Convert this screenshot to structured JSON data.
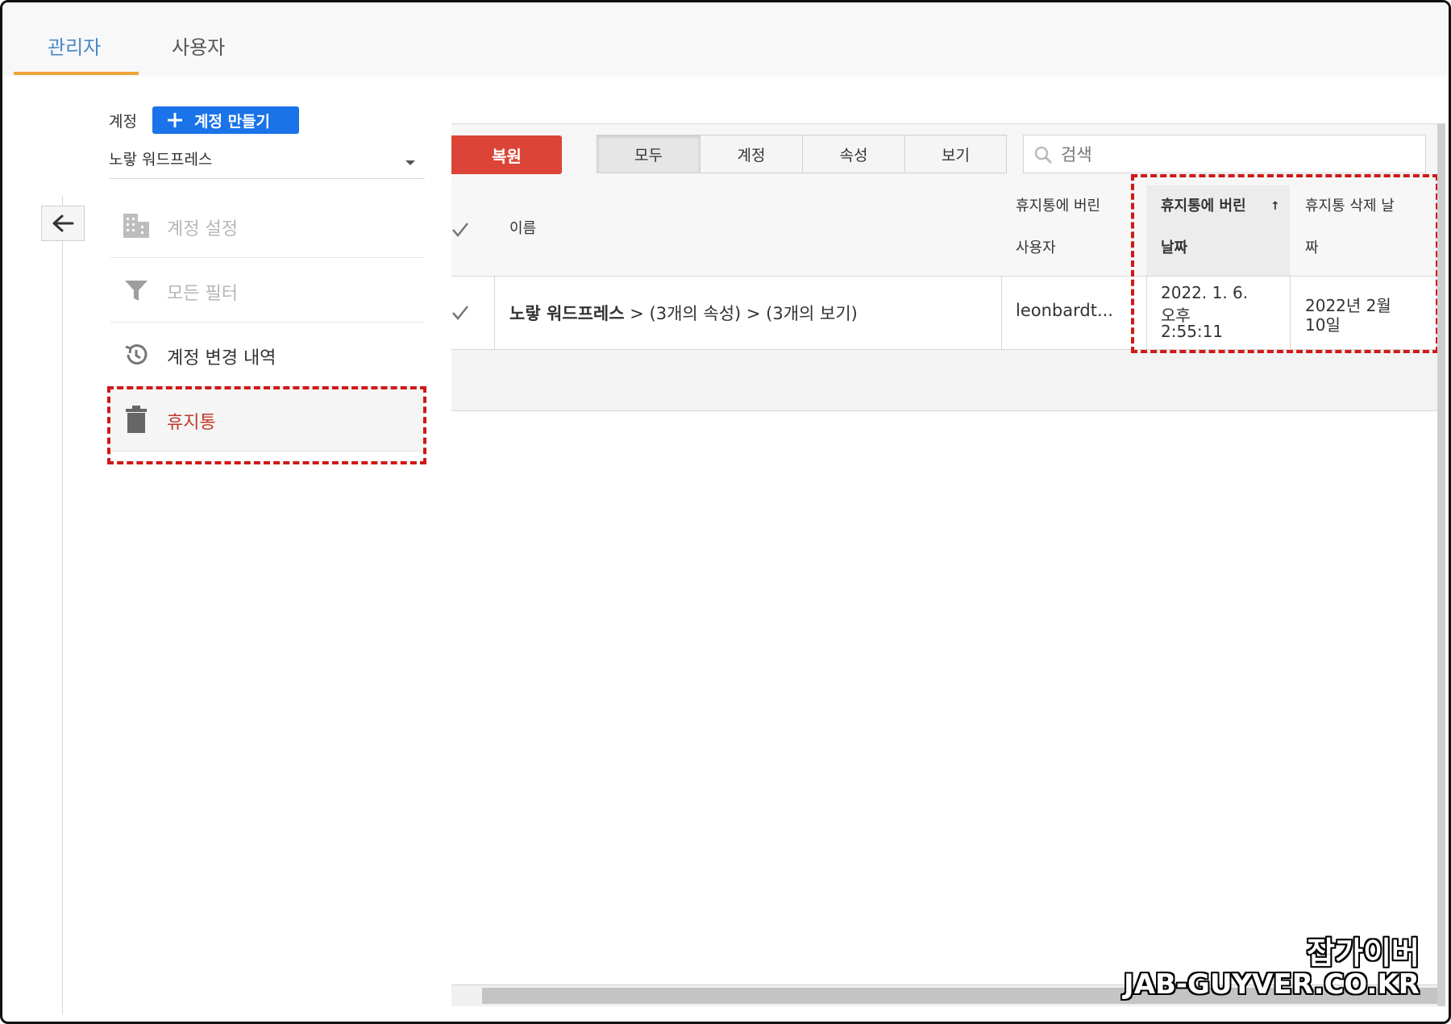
{
  "tabs": {
    "admin": "관리자",
    "users": "사용자"
  },
  "account": {
    "label": "계정",
    "create_button": "계정 만들기",
    "selected": "노랗 워드프레스"
  },
  "menu": [
    {
      "label": "계정 설정",
      "icon": "building-icon",
      "state": "disabled"
    },
    {
      "label": "모든 필터",
      "icon": "filter-icon",
      "state": "disabled"
    },
    {
      "label": "계정 변경 내역",
      "icon": "history-icon",
      "state": "enabled"
    },
    {
      "label": "휴지통",
      "icon": "trash-icon",
      "state": "selected"
    }
  ],
  "toolbar": {
    "restore_button": "복원",
    "filters": [
      "모두",
      "계정",
      "속성",
      "보기"
    ],
    "active_filter": "모두",
    "search_placeholder": "검색"
  },
  "table": {
    "headers": {
      "name": "이름",
      "trashed_by_line1": "휴지통에 버린",
      "trashed_by_line2": "사용자",
      "trashed_date_line1": "휴지통에 버린",
      "trashed_date_line2": "날짜",
      "delete_date_line1": "휴지통 삭제 날",
      "delete_date_line2": "짜",
      "sort_indicator": "↑"
    },
    "rows": [
      {
        "name_main": "노랗 워드프레스",
        "name_rest": " > (3개의 속성) > (3개의 보기)",
        "trashed_by": "leonbardt...",
        "trashed_date_line1": "2022. 1. 6.",
        "trashed_date_line2": "오후",
        "trashed_date_line3": "2:55:11",
        "delete_date_line1": "2022년 2월",
        "delete_date_line2": "10일"
      }
    ]
  },
  "watermark": {
    "line1": "잡가이버",
    "line2": "JAB-GUYVER.CO.KR"
  },
  "colors": {
    "accent_blue": "#1a73e8",
    "restore_red": "#db4437",
    "tab_underline": "#f0a43a",
    "highlight_dashed": "#d01818"
  }
}
